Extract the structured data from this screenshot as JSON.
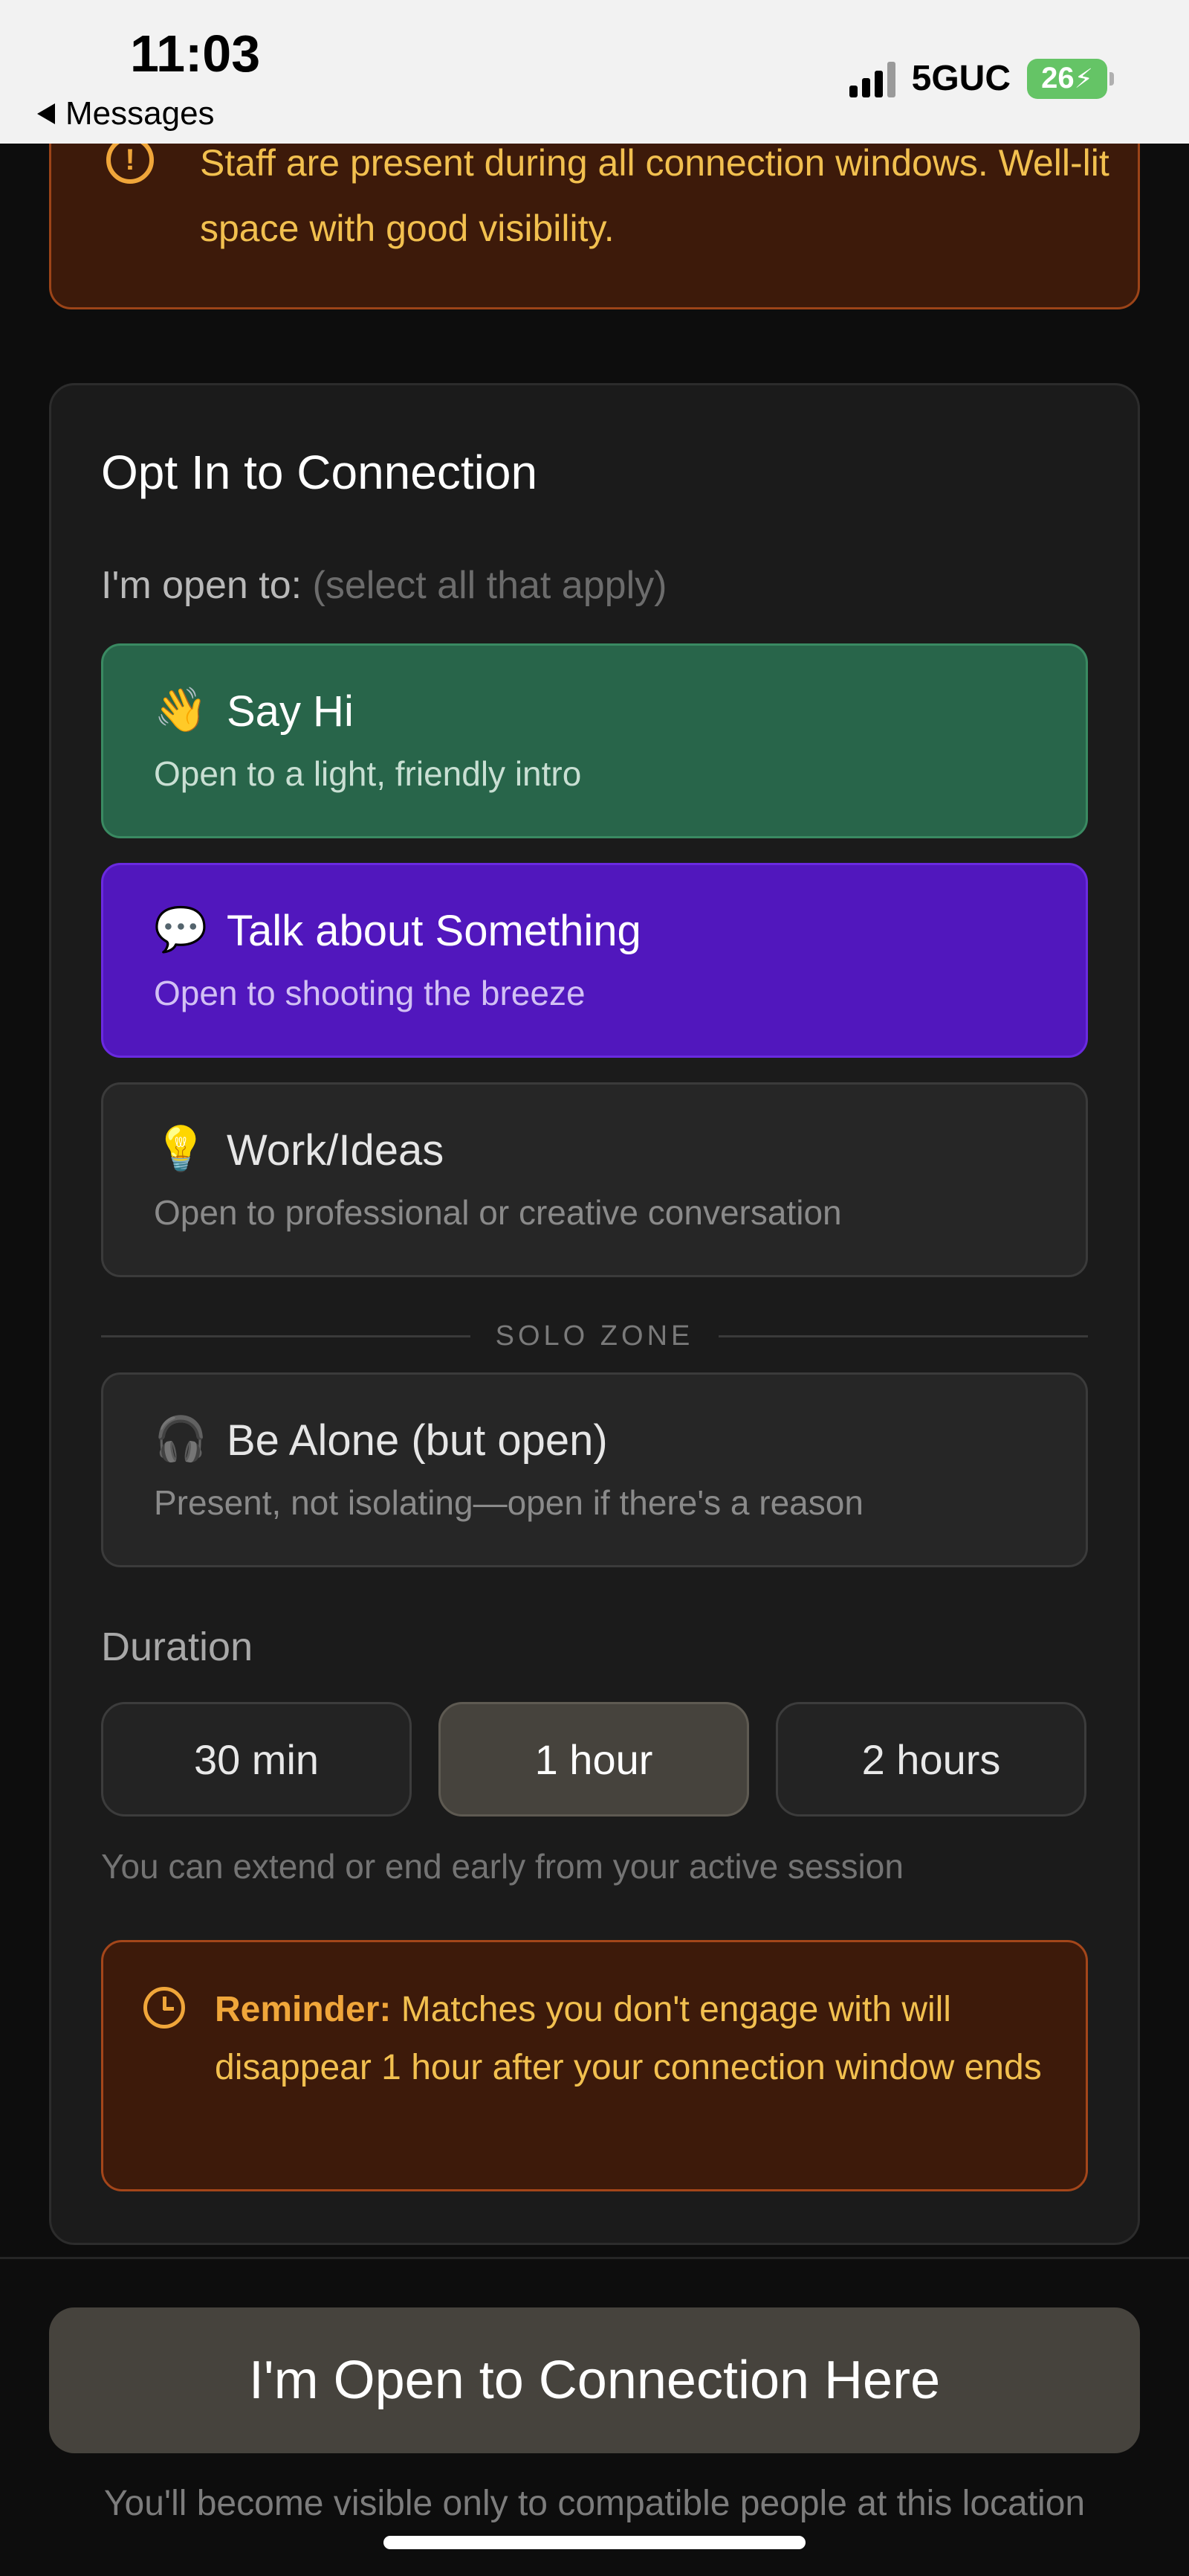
{
  "status_bar": {
    "time": "11:03",
    "back_label": "Messages",
    "network": "5GUC",
    "battery": "26"
  },
  "safety_notice": {
    "icon": "alert-circle-icon",
    "text": "Staff are present during all connection windows. Well-lit space with good visibility."
  },
  "opt_in": {
    "title": "Opt In to Connection",
    "open_to_label": "I'm open to:",
    "open_to_hint": "(select all that apply)",
    "options": [
      {
        "emoji": "👋",
        "title": "Say Hi",
        "subtitle": "Open to a light, friendly intro",
        "selected": true,
        "color": "#28654a"
      },
      {
        "emoji": "💬",
        "title": "Talk about Something",
        "subtitle": "Open to shooting the breeze",
        "selected": true,
        "color": "#5117bd"
      },
      {
        "emoji": "💡",
        "title": "Work/Ideas",
        "subtitle": "Open to professional or creative conversation",
        "selected": false
      }
    ],
    "solo_zone_label": "SOLO ZONE",
    "solo_option": {
      "emoji": "🎧",
      "title": "Be Alone (but open)",
      "subtitle": "Present, not isolating—open if there's a reason",
      "selected": false
    },
    "duration": {
      "label": "Duration",
      "options": [
        "30 min",
        "1 hour",
        "2 hours"
      ],
      "selected": "1 hour",
      "note": "You can extend or end early from your active session"
    },
    "reminder": {
      "icon": "clock-icon",
      "label": "Reminder:",
      "text": "Matches you don't engage with will disappear 1 hour after your connection window ends"
    }
  },
  "cta": {
    "button_label": "I'm Open to Connection Here",
    "note": "You'll become visible only to compatible people at this location"
  },
  "colors": {
    "background": "#0d0d0d",
    "card": "#1b1b1b",
    "accent_warning": "#f0a63a",
    "warning_bg": "#3d1a0a"
  }
}
